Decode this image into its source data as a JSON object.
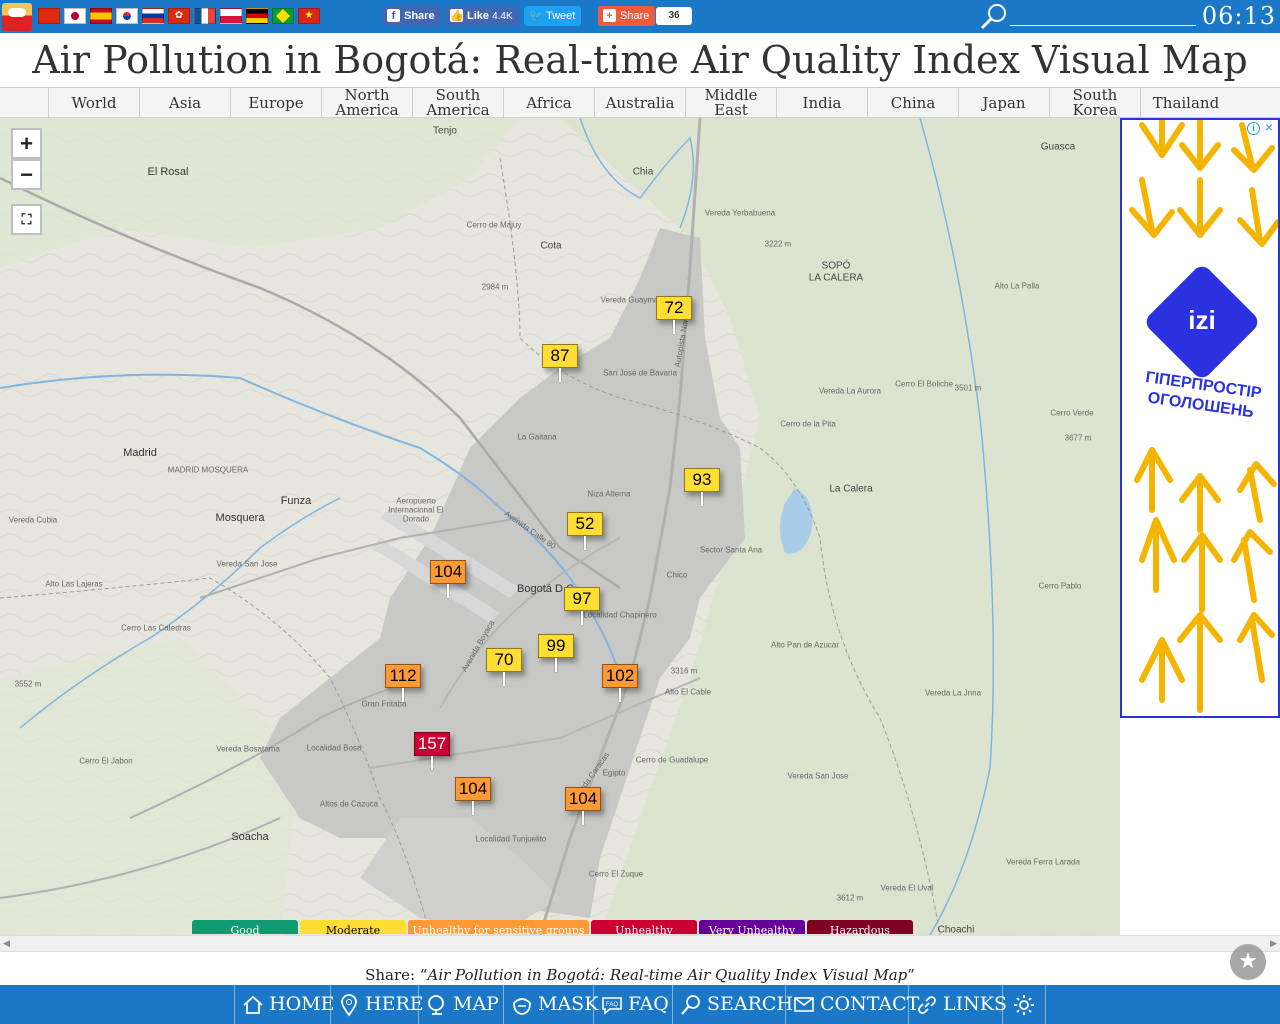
{
  "header": {
    "title": "Air Pollution in Bogotá: Real-time Air Quality Index Visual Map",
    "clock": "06:13",
    "search_placeholder": "",
    "flags": [
      "China",
      "Japan",
      "Spain",
      "South Korea",
      "Russia",
      "Hong Kong",
      "France",
      "Poland",
      "Germany",
      "Brazil",
      "Vietnam"
    ],
    "social": {
      "fb_share": "Share",
      "fb_like": "Like",
      "fb_like_count": "4.4K",
      "tweet": "Tweet",
      "share": "Share",
      "share_count": "36"
    }
  },
  "nav": {
    "items": [
      {
        "label": "World"
      },
      {
        "label": "Asia"
      },
      {
        "label": "Europe"
      },
      {
        "label": "North America"
      },
      {
        "label": "South America"
      },
      {
        "label": "Africa"
      },
      {
        "label": "Australia"
      },
      {
        "label": "Middle East"
      },
      {
        "label": "India"
      },
      {
        "label": "China"
      },
      {
        "label": "Japan"
      },
      {
        "label": "South Korea"
      },
      {
        "label": "Thailand"
      }
    ]
  },
  "map": {
    "zoom_in": "+",
    "zoom_out": "−",
    "stations": [
      {
        "aqi": "72",
        "level": "moderate"
      },
      {
        "aqi": "87",
        "level": "moderate"
      },
      {
        "aqi": "93",
        "level": "moderate"
      },
      {
        "aqi": "52",
        "level": "moderate"
      },
      {
        "aqi": "104",
        "level": "usg"
      },
      {
        "aqi": "97",
        "level": "moderate"
      },
      {
        "aqi": "99",
        "level": "moderate"
      },
      {
        "aqi": "70",
        "level": "moderate"
      },
      {
        "aqi": "112",
        "level": "usg"
      },
      {
        "aqi": "102",
        "level": "usg"
      },
      {
        "aqi": "157",
        "level": "unhealthy"
      },
      {
        "aqi": "104",
        "level": "usg"
      },
      {
        "aqi": "104",
        "level": "usg"
      }
    ],
    "place_labels": [
      "Tenjo",
      "El Rosal",
      "Chia",
      "Vereda Yerbabuena",
      "Cerro de Majuy",
      "Cota",
      "Guasca",
      "3222 m",
      "SOPÓ",
      "LA CALERA",
      "Vereda Guaymaral",
      "Alto La Palla",
      "San José de Bavaria",
      "2984 m",
      "La Gaitana",
      "Vereda La Aurora",
      "Cerro El Boliche",
      "3501 m",
      "Cerro Verde",
      "3677 m",
      "Cerro de la Pita",
      "Madrid",
      "MADRID MOSQUERA",
      "Funza",
      "Aeropuerto Internacional El Dorado",
      "Bogotá D.C.",
      "Niza Alterna",
      "La Calera",
      "Mosquera",
      "Vereda Cubia",
      "Vereda San Jose",
      "Alto Las Lajeras",
      "Cerro Las Catedras",
      "Localidad Chapinero",
      "Sector Santa Ana",
      "Chico",
      "Cerro Pablo",
      "Alto Pan de Azucar",
      "3316 m",
      "Alto El Cable",
      "Gran Fritaba",
      "Vereda Bosatama",
      "Localidad Bosa",
      "Cerro El Jabon",
      "Altos de Cazuca",
      "Soacha",
      "Cerro de Guadalupe",
      "Egipto",
      "Vereda San Jose",
      "Vereda La Jnna",
      "Localidad Tunjuelito",
      "Cerro El Zuque",
      "3612 m",
      "Vereda El Uval",
      "Vereda Ferra Larada",
      "Choachi",
      "3552 m",
      "Avenida Boyaca",
      "Avenida Caracas",
      "Avenida Calle 80",
      "Autopista Norte"
    ]
  },
  "legend": [
    {
      "label": "Good",
      "color": "#109a70",
      "text_color": "#ffffff"
    },
    {
      "label": "Moderate",
      "color": "#ffde33",
      "text_color": "#000000"
    },
    {
      "label": "Unhealthy for sensitive groups",
      "color": "#ff9933",
      "text_color": "#ffffff"
    },
    {
      "label": "Unhealthy",
      "color": "#cc0033",
      "text_color": "#ffffff"
    },
    {
      "label": "Very Unhealthy",
      "color": "#660099",
      "text_color": "#ffffff"
    },
    {
      "label": "Hazardous",
      "color": "#7e0023",
      "text_color": "#ffffff"
    }
  ],
  "level_colors": {
    "moderate": "#ffde33",
    "usg": "#ff9933",
    "unhealthy": "#cc0033"
  },
  "ad": {
    "logo": "izi",
    "text": "ГІПЕРПРОСТІР ОГОЛОШЕНЬ",
    "info": "i",
    "close": "×"
  },
  "share_line": {
    "prefix": "Share: “",
    "title": "Air Pollution in Bogotá: Real-time Air Quality Index Visual Map",
    "suffix": "”"
  },
  "bottom_nav": [
    {
      "label": "HOME",
      "icon": "home-icon"
    },
    {
      "label": "HERE",
      "icon": "location-pin-icon"
    },
    {
      "label": "MAP",
      "icon": "map-magnifier-icon"
    },
    {
      "label": "MASK",
      "icon": "mask-icon"
    },
    {
      "label": "FAQ",
      "icon": "faq-bubble-icon"
    },
    {
      "label": "SEARCH",
      "icon": "search-icon"
    },
    {
      "label": "CONTACT",
      "icon": "contact-icon"
    },
    {
      "label": "LINKS",
      "icon": "link-icon"
    },
    {
      "label": "",
      "icon": "gear-icon"
    }
  ]
}
